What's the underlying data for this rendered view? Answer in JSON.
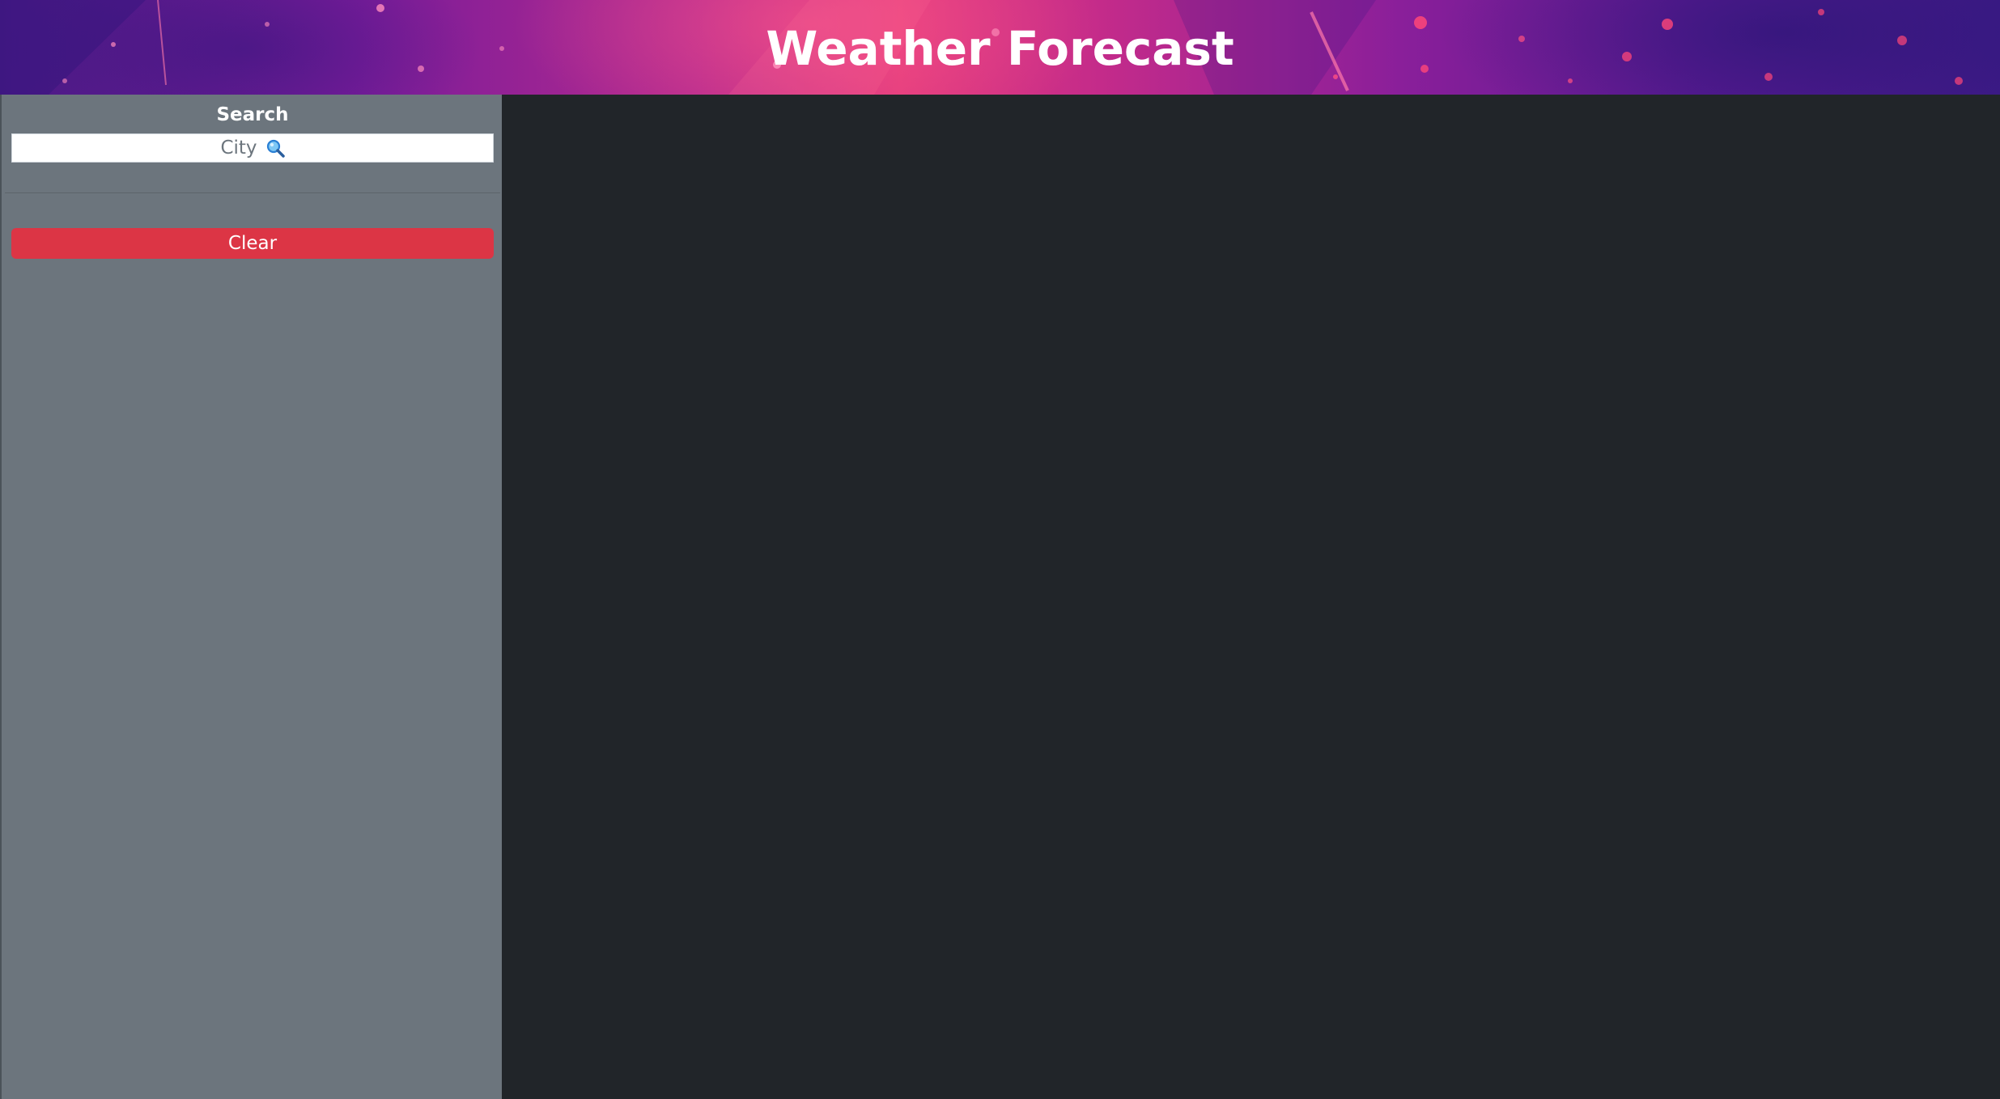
{
  "header": {
    "title": "Weather Forecast"
  },
  "sidebar": {
    "heading": "Search",
    "search": {
      "placeholder": "City",
      "icon": "magnifying-glass-icon"
    },
    "clear_label": "Clear"
  },
  "colors": {
    "sidebar_bg": "#6c757d",
    "main_bg": "#212529",
    "clear_button": "#dc3545",
    "header_text": "#ffffff"
  }
}
